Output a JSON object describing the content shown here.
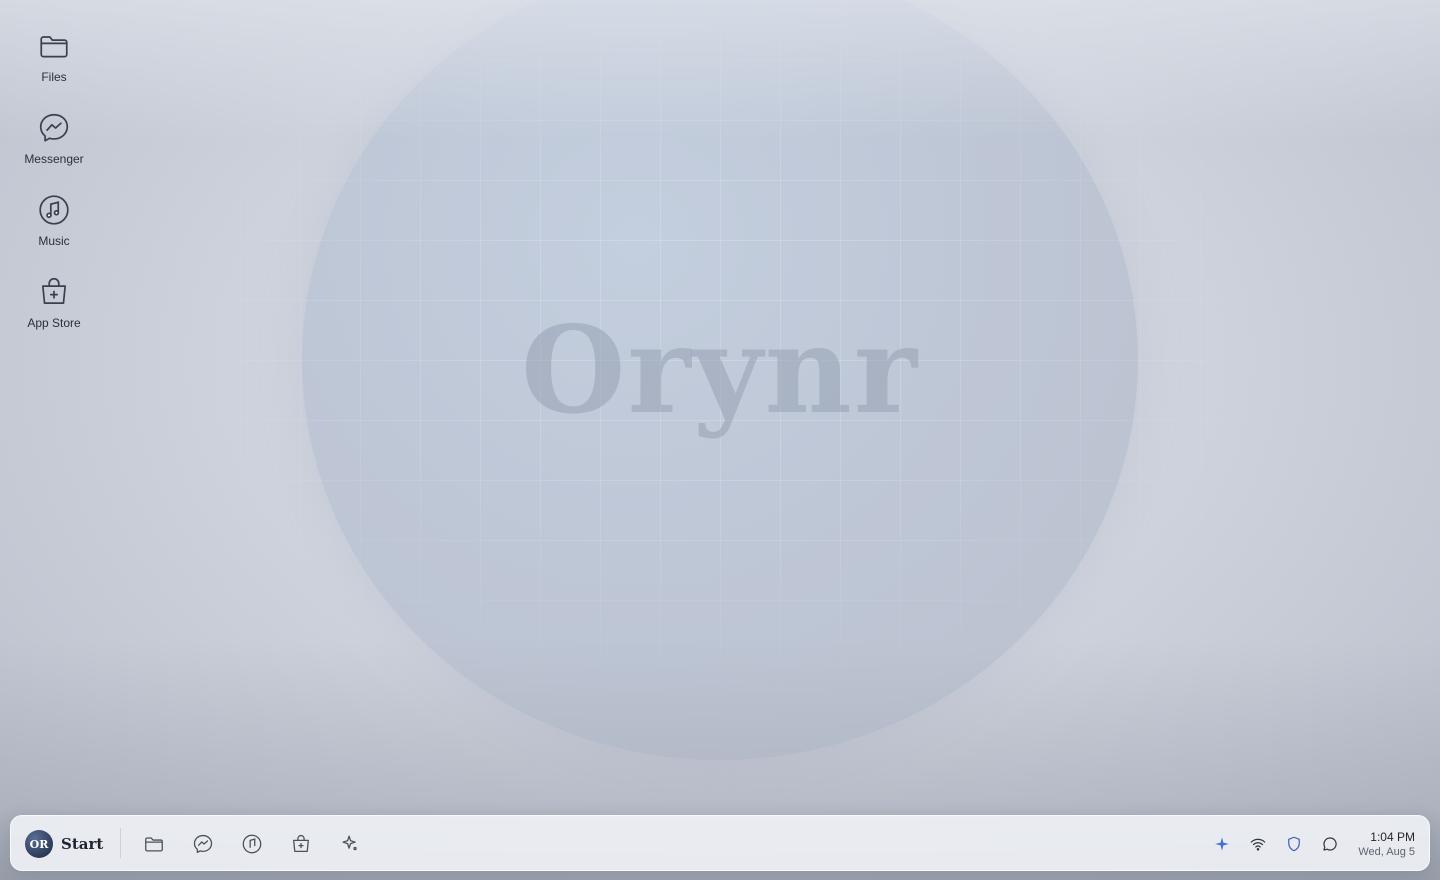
{
  "wallpaper": {
    "brand_text": "Orynr",
    "colors": {
      "background": "#cdd2dc",
      "orb": "#c0c9d8",
      "brand_text": "#96a0b2"
    }
  },
  "desktop_icons": [
    {
      "label": "Files",
      "icon": "folder-icon"
    },
    {
      "label": "Messenger",
      "icon": "messenger-icon"
    },
    {
      "label": "Music",
      "icon": "music-icon"
    },
    {
      "label": "App Store",
      "icon": "shopping-bag-icon"
    }
  ],
  "taskbar": {
    "start": {
      "logo_text": "OR",
      "label": "Start"
    },
    "pinned": [
      {
        "icon": "folder-icon",
        "app": "Files"
      },
      {
        "icon": "messenger-icon",
        "app": "Messenger"
      },
      {
        "icon": "music-icon",
        "app": "Music"
      },
      {
        "icon": "shopping-bag-icon",
        "app": "App Store"
      },
      {
        "icon": "sparkle-icon",
        "app": "Assistant"
      }
    ],
    "tray": [
      {
        "icon": "sparkle-icon",
        "color": "#3d6fd6"
      },
      {
        "icon": "wifi-icon"
      },
      {
        "icon": "shield-icon",
        "color": "#3d5fb8"
      },
      {
        "icon": "chat-bubble-icon"
      }
    ],
    "clock": {
      "time": "1:04 PM",
      "date": "Wed, Aug 5"
    }
  }
}
